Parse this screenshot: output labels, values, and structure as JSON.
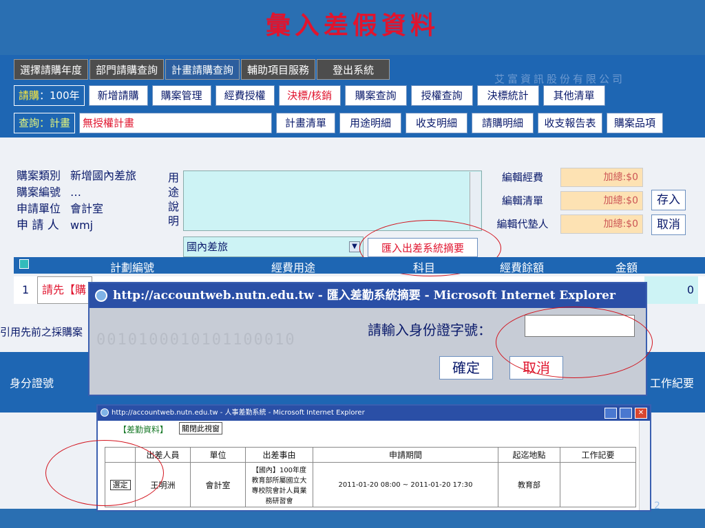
{
  "slide": {
    "title": "彙入差假資料",
    "page_number": "2"
  },
  "topnav": {
    "tabs": [
      "選擇請購年度",
      "部門請購查詢",
      "計畫請購查詢",
      "輔助項目服務",
      "登出系統"
    ],
    "watermark": "艾富資訊股份有限公司"
  },
  "purchase_bar": {
    "label_prefix": "請購",
    "label_year": "：100年",
    "buttons": [
      "新增請購",
      "購案管理",
      "經費授權",
      "決標/核銷",
      "購案查詢",
      "授權查詢",
      "決標統計",
      "其他清單"
    ]
  },
  "query_bar": {
    "label": "查詢：計畫",
    "value": "無授權計畫",
    "buttons": [
      "計畫清單",
      "用途明細",
      "收支明細",
      "請購明細",
      "收支報告表",
      "購案品項"
    ]
  },
  "form": {
    "fields": [
      {
        "label": "購案類別",
        "value": "新增國內差旅"
      },
      {
        "label": "購案編號",
        "value": "…"
      },
      {
        "label": "申請單位",
        "value": "會計室"
      },
      {
        "label": "申 請 人",
        "value": "wmj"
      }
    ],
    "usage_label": "用途說明",
    "select_value": "國內差旅",
    "import_button": "匯入出差系統摘要",
    "edit_buttons": [
      "編輯經費",
      "編輯清單",
      "編輯代墊人"
    ],
    "totals": [
      "加總:$0",
      "加總:$0",
      "加總:$0"
    ],
    "save_button": "存入",
    "cancel_button": "取消"
  },
  "table": {
    "headers": [
      "計劃編號",
      "經費用途",
      "科目",
      "經費餘額",
      "金額"
    ],
    "row_index": "1",
    "row_text": "請先【購",
    "row_amount": "0",
    "left_hint": "引用先前之採購案",
    "id_col": "身分證號",
    "work_col": "工作紀要"
  },
  "dialog": {
    "title": "http://accountweb.nutn.edu.tw - 匯入差勤系統摘要 - Microsoft Internet Explorer",
    "prompt": "請輸入身份證字號：",
    "input_value": "",
    "ok": "確定",
    "cancel": "取消",
    "watermark": "0010100010101100010"
  },
  "popup": {
    "title": "http://accountweb.nutn.edu.tw - 人事差勤系統 - Microsoft Internet Explorer",
    "section_label": "【差勤資料】",
    "close_button": "關閉此視窗",
    "columns": [
      "出差人員",
      "單位",
      "出差事由",
      "申請期間",
      "起迄地點",
      "工作記要"
    ],
    "rows": [
      {
        "select": "選定",
        "person": "王明洲",
        "unit": "會計室",
        "reason": "【國內】100年度教育部所屬國立大專校院會計人員業務研習會",
        "period": "2011-01-20 08:00 ~ 2011-01-20 17:30",
        "place": "教育部",
        "notes": ""
      }
    ]
  }
}
